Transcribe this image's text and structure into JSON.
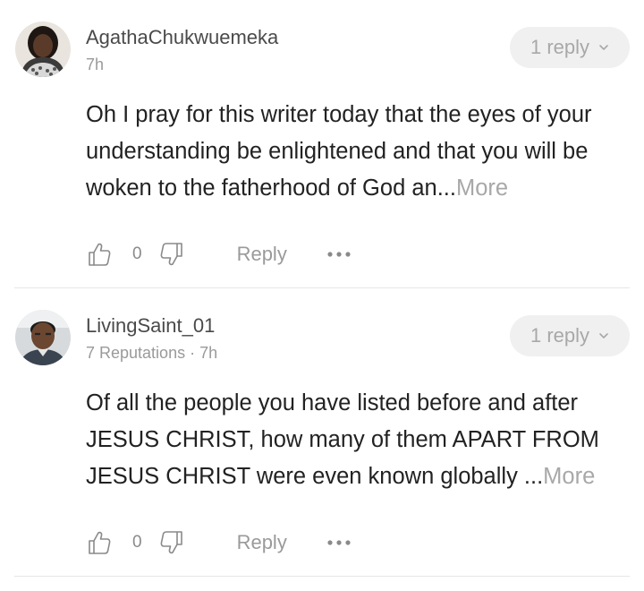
{
  "comments": [
    {
      "username": "AgathaChukwuemeka",
      "meta": "7h",
      "reply_count_label": "1 reply",
      "body": "Oh I pray for this writer today that the eyes of your understanding be enlightened and that you will be woken to the fatherhood of God an...",
      "more_label": "More",
      "likes": "0",
      "reply_label": "Reply",
      "avatar_icon": "avatar-woman-photo"
    },
    {
      "username": "LivingSaint_01",
      "meta": "7 Reputations · 7h",
      "reply_count_label": "1 reply",
      "body": "Of all the people you have listed before and after JESUS CHRIST, how many of them APART FROM JESUS CHRIST were even known globally ...",
      "more_label": "More",
      "likes": "0",
      "reply_label": "Reply",
      "avatar_icon": "avatar-man-photo"
    }
  ],
  "colors": {
    "text": "#222222",
    "muted": "#9a9a9a",
    "pill_bg": "#f0f0f0",
    "divider": "#e6e6e6"
  }
}
